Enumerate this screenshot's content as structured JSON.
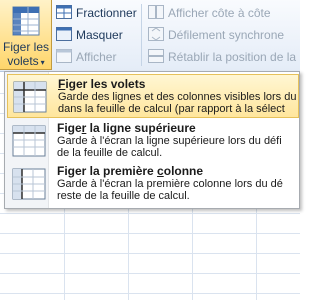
{
  "ribbon": {
    "split_button": {
      "line1": "Figer les",
      "line2": "volets"
    },
    "fractionner": "Fractionner",
    "masquer": "Masquer",
    "afficher": "Afficher",
    "afficher_cote": "Afficher côte à côte",
    "defilement": "Défilement synchrone",
    "retablir": "Rétablir la position de la"
  },
  "menu": {
    "items": [
      {
        "title_underline": "F",
        "title_rest": "iger les volets",
        "desc": [
          "Garde des lignes et des colonnes visibles lors du",
          "dans la feuille de calcul (par rapport à la sélect"
        ]
      },
      {
        "title_underline": "",
        "title_pre": "Fige",
        "title_ul": "r",
        "title_rest": " la ligne supérieure",
        "desc": [
          "Garde à l'écran la ligne supérieure lors du défi",
          "de la feuille de calcul."
        ]
      },
      {
        "title_pre": "Figer la première ",
        "title_ul": "c",
        "title_rest": "olonne",
        "desc": [
          "Garde à l'écran la première colonne lors du dé",
          "reste de la feuille de calcul."
        ]
      }
    ]
  },
  "colors": {
    "accent_hover": "#ffe69d",
    "ribbon_text": "#1e395b"
  }
}
